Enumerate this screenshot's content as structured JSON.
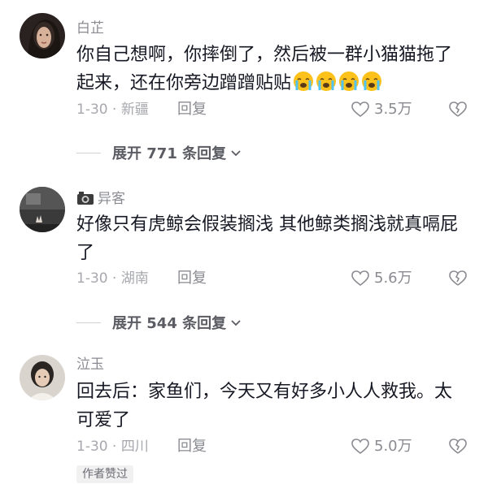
{
  "comments": [
    {
      "username": "白芷",
      "text": "你自己想啊，你摔倒了，然后被一群小猫猫拖了起来，还在你旁边蹭蹭贴贴",
      "emoji_icon": "crying-face-icon",
      "date": "1-30",
      "location": "新疆",
      "reply_label": "回复",
      "likes": "3.5万",
      "expand_label": "展开 771 条回复"
    },
    {
      "username": "异客",
      "text": "好像只有虎鲸会假装搁浅 其他鲸类搁浅就真嗝屁了",
      "date": "1-30",
      "location": "湖南",
      "reply_label": "回复",
      "likes": "5.6万",
      "expand_label": "展开 544 条回复"
    },
    {
      "username": "泣玉",
      "text": "回去后：家鱼们，今天又有好多小人人救我。太可爱了",
      "date": "1-30",
      "location": "四川",
      "reply_label": "回复",
      "likes": "5.0万",
      "badge": "作者赞过"
    }
  ]
}
